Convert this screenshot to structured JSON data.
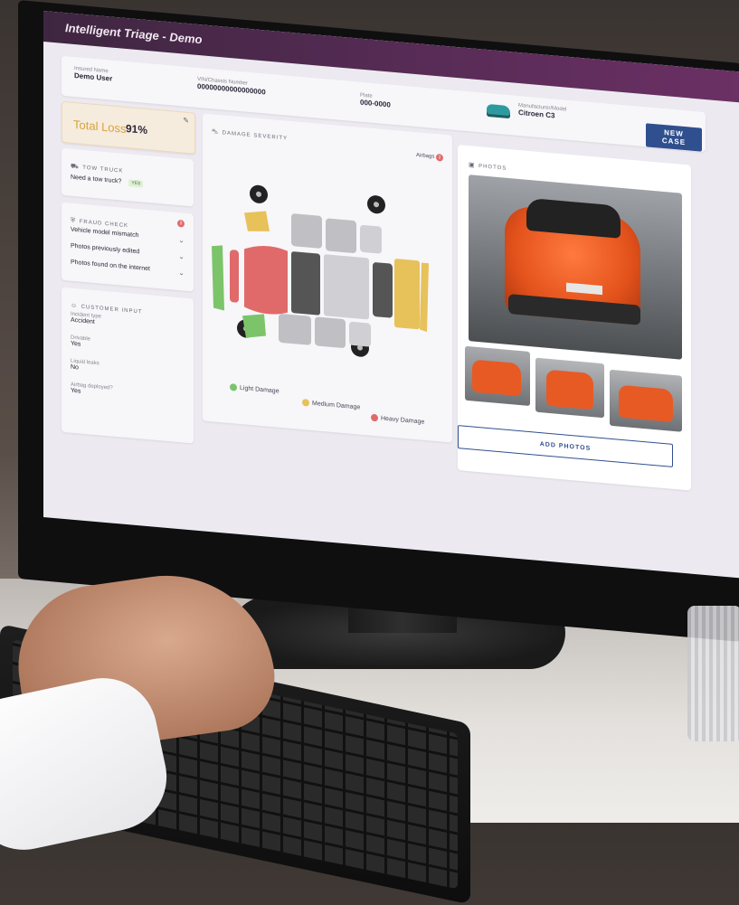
{
  "app": {
    "title": "Intelligent Triage - Demo"
  },
  "header": {
    "insured_label": "Insured Name",
    "insured_value": "Demo User",
    "vin_label": "VIN/Chassis Number",
    "vin_value": "00000000000000000",
    "plate_label": "Plate",
    "plate_value": "000-0000",
    "model_label": "Manufacturer/Model",
    "model_value": "Citroen C3",
    "new_case_label": "NEW CASE"
  },
  "total_loss": {
    "label": "Total Loss",
    "value": "91%"
  },
  "tow_truck": {
    "title": "TOW TRUCK",
    "question": "Need a tow truck?",
    "answer": "YES"
  },
  "fraud_check": {
    "title": "FRAUD CHECK",
    "count": "3",
    "items": [
      "Vehicle model mismatch",
      "Photos previously edited",
      "Photos found on the internet"
    ]
  },
  "customer_input": {
    "title": "CUSTOMER INPUT",
    "fields": [
      {
        "label": "Incident type",
        "value": "Accident"
      },
      {
        "label": "Drivable",
        "value": "Yes"
      },
      {
        "label": "Liquid leaks",
        "value": "No"
      },
      {
        "label": "Airbag deployed?",
        "value": "Yes"
      }
    ]
  },
  "damage": {
    "title": "DAMAGE SEVERITY",
    "airbags_label": "Airbags",
    "airbags_count": "2",
    "legend": [
      {
        "label": "Light Damage",
        "color": "#7cc46a"
      },
      {
        "label": "Medium Damage",
        "color": "#e7c15a"
      },
      {
        "label": "Heavy Damage",
        "color": "#e06a6a"
      }
    ]
  },
  "photos": {
    "title": "PHOTOS",
    "add_label": "ADD PHOTOS"
  },
  "colors": {
    "accent": "#2f4f8e",
    "topbar": "#5a2c58",
    "car": "#ef5a22"
  }
}
